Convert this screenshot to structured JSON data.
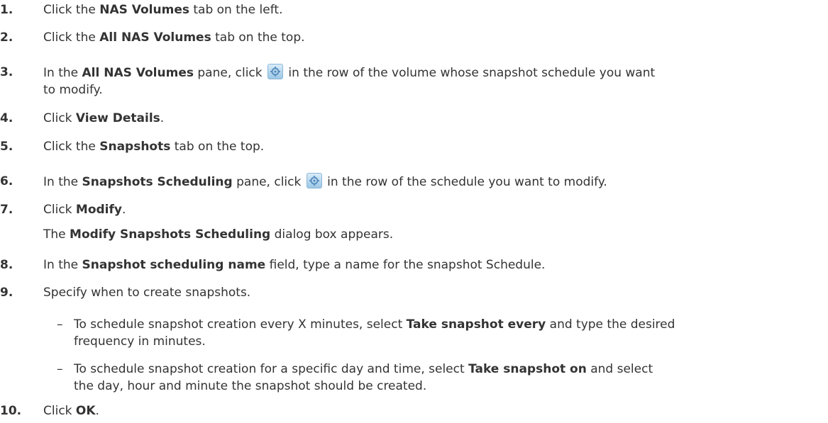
{
  "steps": [
    {
      "num": "1.",
      "a": "Click the ",
      "b1": "NAS Volumes",
      "c": " tab on the left."
    },
    {
      "num": "2.",
      "a": "Click the ",
      "b1": "All NAS Volumes",
      "c": " tab on the top."
    },
    {
      "num": "3.",
      "a": "In the ",
      "b1": "All NAS Volumes",
      "c": " pane, click ",
      "d": " in the row of the volume whose snapshot schedule you want",
      "cont": "to modify.",
      "icon": "gear-icon"
    },
    {
      "num": "4.",
      "a": "Click ",
      "b1": "View Details",
      "c": "."
    },
    {
      "num": "5.",
      "a": "Click the ",
      "b1": "Snapshots",
      "c": " tab on the top."
    },
    {
      "num": "6.",
      "a": "In the ",
      "b1": "Snapshots Scheduling",
      "c": " pane, click ",
      "d": " in the row of the schedule you want to modify.",
      "icon": "gear-icon"
    },
    {
      "num": "7.",
      "a": "Click ",
      "b1": "Modify",
      "c": ".",
      "cont_a": "The ",
      "cont_b": "Modify Snapshots Scheduling",
      "cont_c": " dialog box appears."
    },
    {
      "num": "8.",
      "a": "In the ",
      "b1": "Snapshot scheduling name",
      "c": " field, type a name for the snapshot Schedule."
    },
    {
      "num": "9.",
      "a": "Specify when to create snapshots."
    },
    {
      "num": "10.",
      "a": "Click ",
      "b1": "OK",
      "c": "."
    }
  ],
  "substeps": [
    {
      "dash": "–",
      "a": "To schedule snapshot creation every X minutes, select ",
      "b1": "Take snapshot every",
      "c": " and type the desired",
      "cont": "frequency in minutes."
    },
    {
      "dash": "–",
      "a": "To schedule snapshot creation for a specific day and time, select ",
      "b1": "Take snapshot on",
      "c": " and select",
      "cont": "the day, hour and minute the snapshot should be created."
    }
  ]
}
